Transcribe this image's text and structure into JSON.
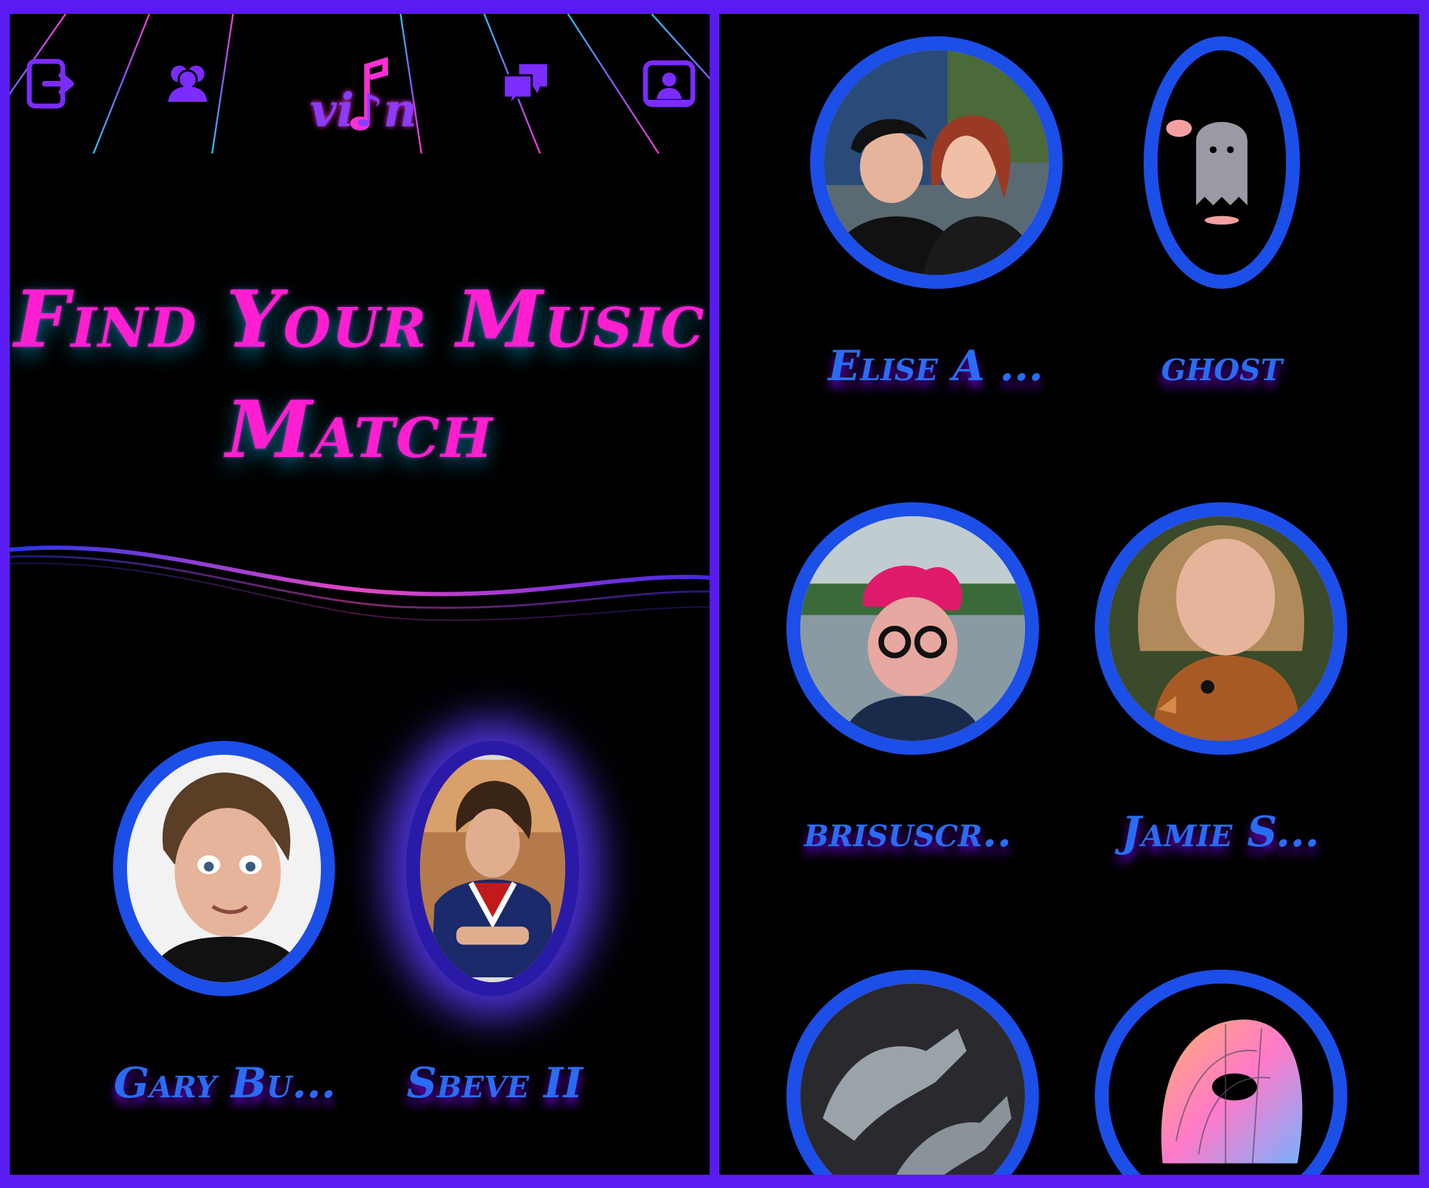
{
  "app": {
    "logo_text": "vi♪n"
  },
  "nav": {
    "icons": [
      "logout-icon",
      "friends-icon",
      "music-note-logo",
      "chat-icon",
      "profile-icon"
    ]
  },
  "left": {
    "title": "Find Your Music Match",
    "matches": [
      {
        "name": "Gary Bu...",
        "selected": false
      },
      {
        "name": "Sbeve II",
        "selected": true
      }
    ]
  },
  "right": {
    "matches": [
      {
        "name": "Elise A ..."
      },
      {
        "name": "ghost"
      },
      {
        "name": "brisuscr.."
      },
      {
        "name": "Jamie S..."
      },
      {
        "name": ""
      },
      {
        "name": ""
      }
    ]
  },
  "colors": {
    "frame": "#5a1bf0",
    "accent_pink": "#ff1fd1",
    "accent_blue": "#1c4ee8",
    "name_blue": "#2a6cf4"
  }
}
